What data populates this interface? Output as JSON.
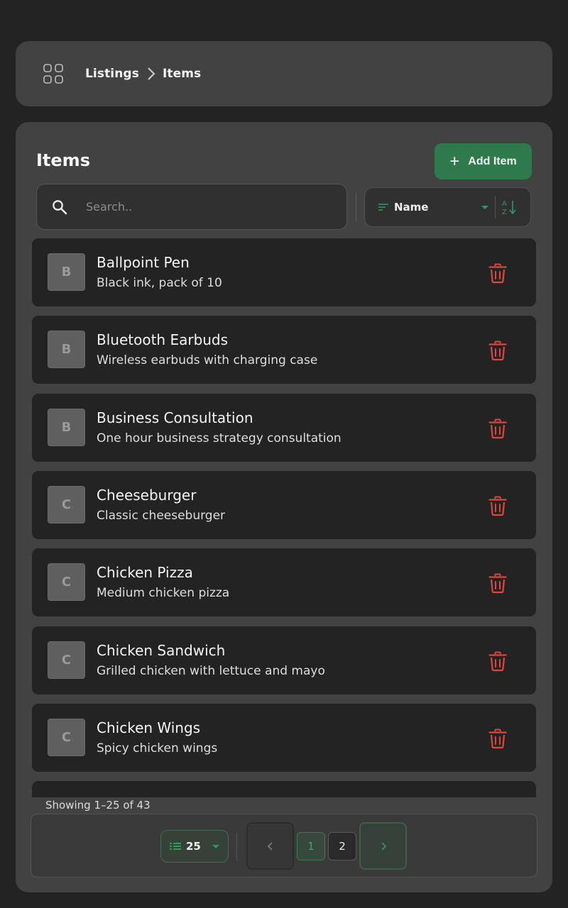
{
  "breadcrumb": {
    "root": "Listings",
    "current": "Items"
  },
  "panel": {
    "title": "Items",
    "add_label": "Add Item"
  },
  "search": {
    "placeholder": "Search.."
  },
  "sort": {
    "label": "Name"
  },
  "items": [
    {
      "initial": "B",
      "name": "Ballpoint Pen",
      "description": "Black ink, pack of 10"
    },
    {
      "initial": "B",
      "name": "Bluetooth Earbuds",
      "description": "Wireless earbuds with charging case"
    },
    {
      "initial": "B",
      "name": "Business Consultation",
      "description": "One hour business strategy consultation"
    },
    {
      "initial": "C",
      "name": "Cheeseburger",
      "description": "Classic cheeseburger"
    },
    {
      "initial": "C",
      "name": "Chicken Pizza",
      "description": "Medium chicken pizza"
    },
    {
      "initial": "C",
      "name": "Chicken Sandwich",
      "description": "Grilled chicken with lettuce and mayo"
    },
    {
      "initial": "C",
      "name": "Chicken Wings",
      "description": "Spicy chicken wings"
    },
    {
      "initial": "",
      "name": "",
      "description": ""
    }
  ],
  "pagination": {
    "showing": "Showing 1–25 of 43",
    "per_page": "25",
    "pages": [
      "1",
      "2"
    ],
    "current_page": "1"
  },
  "colors": {
    "accent": "#2f7a4c",
    "delete": "#e0463c",
    "card": "#232323",
    "panel": "#424242"
  },
  "icons": {
    "menu": "grid-icon",
    "separator": "chevron-right-icon",
    "search": "search-icon",
    "sort": "sort-lines-icon",
    "order": "sort-az-icon",
    "delete": "trash-icon",
    "per_page": "list-icon",
    "prev": "chevron-left-icon",
    "next": "chevron-right-icon"
  }
}
